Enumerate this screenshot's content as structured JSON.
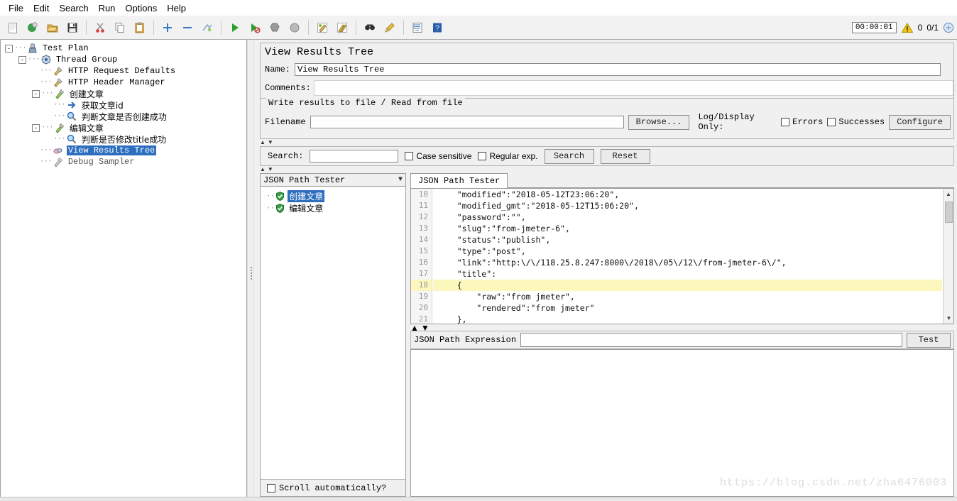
{
  "window": {
    "app": "Apache JMeter"
  },
  "menubar": {
    "items": [
      {
        "label": "File"
      },
      {
        "label": "Edit"
      },
      {
        "label": "Search"
      },
      {
        "label": "Run"
      },
      {
        "label": "Options"
      },
      {
        "label": "Help"
      }
    ]
  },
  "toolbar": {
    "buttons": [
      {
        "name": "new-icon",
        "title": "New"
      },
      {
        "name": "templates-icon",
        "title": "Templates"
      },
      {
        "name": "open-icon",
        "title": "Open"
      },
      {
        "name": "save-icon",
        "title": "Save Test Plan"
      },
      {
        "name": "cut-icon",
        "title": "Cut"
      },
      {
        "name": "copy-icon",
        "title": "Copy"
      },
      {
        "name": "paste-icon",
        "title": "Paste"
      },
      {
        "name": "expand-all-icon",
        "title": "Expand All"
      },
      {
        "name": "collapse-all-icon",
        "title": "Collapse All"
      },
      {
        "name": "toggle-icon",
        "title": "Toggle"
      },
      {
        "name": "start-icon",
        "title": "Start"
      },
      {
        "name": "start-no-pauses-icon",
        "title": "Start no pauses"
      },
      {
        "name": "stop-icon",
        "title": "Stop"
      },
      {
        "name": "shutdown-icon",
        "title": "Shutdown"
      },
      {
        "name": "clear-icon",
        "title": "Clear"
      },
      {
        "name": "clear-all-icon",
        "title": "Clear All"
      },
      {
        "name": "search-icon",
        "title": "Search"
      },
      {
        "name": "search-reset-icon",
        "title": "Reset Search"
      },
      {
        "name": "function-helper-icon",
        "title": "Function Helper Dialog"
      },
      {
        "name": "help-icon",
        "title": "Help"
      }
    ]
  },
  "status": {
    "timer": "00:00:01",
    "warning_count": "0",
    "threads": "0/1"
  },
  "tree": {
    "nodes": [
      {
        "label": "Test Plan",
        "depth": 0,
        "icon": "test-plan-icon",
        "toggle": "-",
        "selected": false,
        "cjk": false,
        "dim": false
      },
      {
        "label": "Thread Group",
        "depth": 1,
        "icon": "thread-group-icon",
        "toggle": "-",
        "selected": false,
        "cjk": false,
        "dim": false
      },
      {
        "label": "HTTP Request Defaults",
        "depth": 2,
        "icon": "config-icon",
        "toggle": "",
        "selected": false,
        "cjk": false,
        "dim": false
      },
      {
        "label": "HTTP Header Manager",
        "depth": 2,
        "icon": "config-icon",
        "toggle": "",
        "selected": false,
        "cjk": false,
        "dim": false
      },
      {
        "label": "创建文章",
        "depth": 2,
        "icon": "http-sampler-icon",
        "toggle": "-",
        "selected": false,
        "cjk": true,
        "dim": false
      },
      {
        "label": "获取文章id",
        "depth": 3,
        "icon": "post-processor-icon",
        "toggle": "",
        "selected": false,
        "cjk": true,
        "dim": false
      },
      {
        "label": "判断文章是否创建成功",
        "depth": 3,
        "icon": "assertion-icon",
        "toggle": "",
        "selected": false,
        "cjk": true,
        "dim": false
      },
      {
        "label": "编辑文章",
        "depth": 2,
        "icon": "http-sampler-icon",
        "toggle": "-",
        "selected": false,
        "cjk": true,
        "dim": false
      },
      {
        "label": "判断是否修改title成功",
        "depth": 3,
        "icon": "assertion-icon",
        "toggle": "",
        "selected": false,
        "cjk": true,
        "dim": false
      },
      {
        "label": "View Results Tree",
        "depth": 2,
        "icon": "listener-icon",
        "toggle": "",
        "selected": true,
        "cjk": false,
        "dim": false
      },
      {
        "label": "Debug Sampler",
        "depth": 2,
        "icon": "debug-sampler-icon",
        "toggle": "",
        "selected": false,
        "cjk": false,
        "dim": true
      }
    ]
  },
  "main": {
    "title": "View Results Tree",
    "name_label": "Name:",
    "name_value": "View Results Tree",
    "comments_label": "Comments:",
    "comments_value": "",
    "file_group_legend": "Write results to file / Read from file",
    "filename_label": "Filename",
    "filename_value": "",
    "browse_label": "Browse...",
    "log_display_label": "Log/Display Only:",
    "errors_label": "Errors",
    "errors_checked": false,
    "successes_label": "Successes",
    "successes_checked": false,
    "configure_label": "Configure",
    "search_label": "Search:",
    "search_value": "",
    "case_sensitive_label": "Case sensitive",
    "case_sensitive_checked": false,
    "regular_exp_label": "Regular exp.",
    "regular_exp_checked": false,
    "search_button": "Search",
    "reset_button": "Reset"
  },
  "results": {
    "render_selector": "JSON Path Tester",
    "samples": [
      {
        "label": "创建文章",
        "status": "success",
        "selected": true
      },
      {
        "label": "编辑文章",
        "status": "success",
        "selected": false
      }
    ],
    "scroll_automatically_label": "Scroll automatically?",
    "scroll_automatically_checked": false,
    "tab_label": "JSON Path Tester",
    "expression_label": "JSON Path Expression",
    "expression_value": "",
    "test_button": "Test",
    "test_result_value": ""
  },
  "json_view": {
    "first_line_number": 10,
    "highlight_line": 18,
    "lines": [
      "    \"modified\":\"2018-05-12T23:06:20\",",
      "    \"modified_gmt\":\"2018-05-12T15:06:20\",",
      "    \"password\":\"\",",
      "    \"slug\":\"from-jmeter-6\",",
      "    \"status\":\"publish\",",
      "    \"type\":\"post\",",
      "    \"link\":\"http:\\/\\/118.25.8.247:8000\\/2018\\/05\\/12\\/from-jmeter-6\\/\",",
      "    \"title\":",
      "    {",
      "        \"raw\":\"from jmeter\",",
      "        \"rendered\":\"from jmeter\"",
      "    },"
    ]
  },
  "watermark": "https://blog.csdn.net/zha6476003",
  "colors": {
    "selection": "#2d6ebf",
    "highlight_line": "#fbf7bd",
    "panel_bg": "#f0f0f0",
    "border": "#b4b4b4"
  }
}
